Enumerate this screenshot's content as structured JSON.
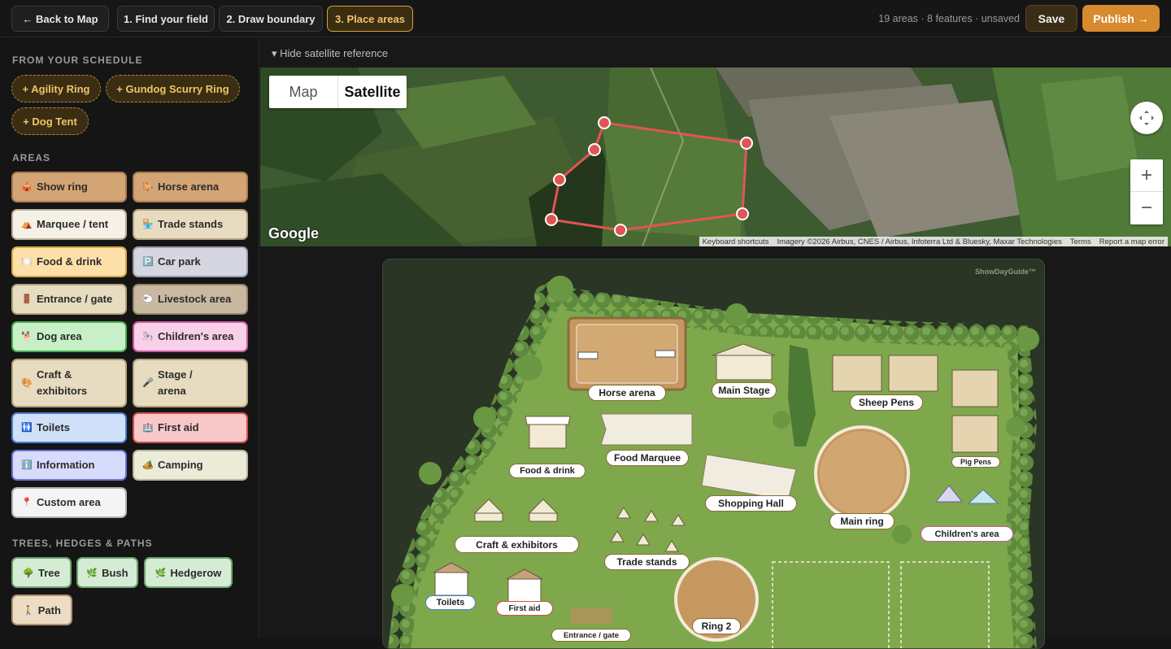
{
  "topbar": {
    "back": "← Back to Map",
    "steps": [
      "1. Find your field",
      "2. Draw boundary",
      "3. Place areas"
    ],
    "status": "19 areas · 8 features · unsaved",
    "save": "Save",
    "publish": "Publish →"
  },
  "sidebar": {
    "schedule_heading": "FROM YOUR SCHEDULE",
    "schedule": [
      "+ Agility Ring",
      "+ Gundog Scurry Ring",
      "+ Dog Tent"
    ],
    "areas_heading": "AREAS",
    "areas": [
      {
        "label": "Show ring",
        "icon": "🎪",
        "bg": "#d4a574",
        "border": "#a67c52"
      },
      {
        "label": "Horse arena",
        "icon": "🐎",
        "bg": "#d4a574",
        "border": "#a67c52"
      },
      {
        "label": "Marquee / tent",
        "icon": "⛺",
        "bg": "#f5f1e8",
        "border": "#b8ae98"
      },
      {
        "label": "Trade stands",
        "icon": "🏪",
        "bg": "#e8dcc0",
        "border": "#b0a27e"
      },
      {
        "label": "Food & drink",
        "icon": "🍽️",
        "bg": "#fde0a8",
        "border": "#d6a84c"
      },
      {
        "label": "Car park",
        "icon": "🅿️",
        "bg": "#d6d6e0",
        "border": "#9c9cb0"
      },
      {
        "label": "Entrance / gate",
        "icon": "🚪",
        "bg": "#e8dcc0",
        "border": "#b0a27e"
      },
      {
        "label": "Livestock area",
        "icon": "🐑",
        "bg": "#c9b9a0",
        "border": "#968468"
      },
      {
        "label": "Dog area",
        "icon": "🐕",
        "bg": "#c8f0c8",
        "border": "#4caf50"
      },
      {
        "label": "Children's area",
        "icon": "🎠",
        "bg": "#f8d0e8",
        "border": "#c85aa0"
      },
      {
        "label": "Craft & exhibitors",
        "icon": "🎨",
        "bg": "#e8dcc0",
        "border": "#b0a27e"
      },
      {
        "label": "Stage / arena",
        "icon": "🎤",
        "bg": "#e8dcc0",
        "border": "#b0a27e"
      },
      {
        "label": "Toilets",
        "icon": "🚻",
        "bg": "#cfe0f8",
        "border": "#4a7fd0"
      },
      {
        "label": "First aid",
        "icon": "🏥",
        "bg": "#f8c8c8",
        "border": "#d05050"
      },
      {
        "label": "Information",
        "icon": "ℹ️",
        "bg": "#d8dcfc",
        "border": "#6a74d8"
      },
      {
        "label": "Camping",
        "icon": "🏕️",
        "bg": "#ecebd8",
        "border": "#b8b69c"
      },
      {
        "label": "Custom area",
        "icon": "📍",
        "bg": "#f4f4f4",
        "border": "#b0b0b0"
      }
    ],
    "trees_heading": "TREES, HEDGES & PATHS",
    "trees": [
      {
        "label": "Tree",
        "icon": "🌳"
      },
      {
        "label": "Bush",
        "icon": "🌿"
      },
      {
        "label": "Hedgerow",
        "icon": "🌿"
      },
      {
        "label": "Path",
        "icon": "🚶"
      }
    ]
  },
  "main": {
    "hide_satellite": "▾ Hide satellite reference",
    "map_tab": "Map",
    "satellite_tab": "Satellite",
    "google": "Google",
    "attribution": [
      "Keyboard shortcuts",
      "Imagery ©2026 Airbus, CNES / Airbus, Infoterra Ltd & Bluesky, Maxar Technologies",
      "Terms",
      "Report a map error"
    ],
    "watermark": "ShowDayGuide™"
  },
  "plan_labels": {
    "horse_arena": "Horse arena",
    "main_stage": "Main Stage",
    "sheep_pens": "Sheep Pens",
    "food_drink": "Food & drink",
    "food_marquee": "Food Marquee",
    "pig_pens": "Pig Pens",
    "shopping_hall": "Shopping Hall",
    "main_ring": "Main ring",
    "childrens_area": "Children's area",
    "craft": "Craft & exhibitors",
    "trade_stands": "Trade stands",
    "toilets": "Toilets",
    "first_aid": "First aid",
    "ring2": "Ring 2",
    "entrance": "Entrance / gate"
  }
}
